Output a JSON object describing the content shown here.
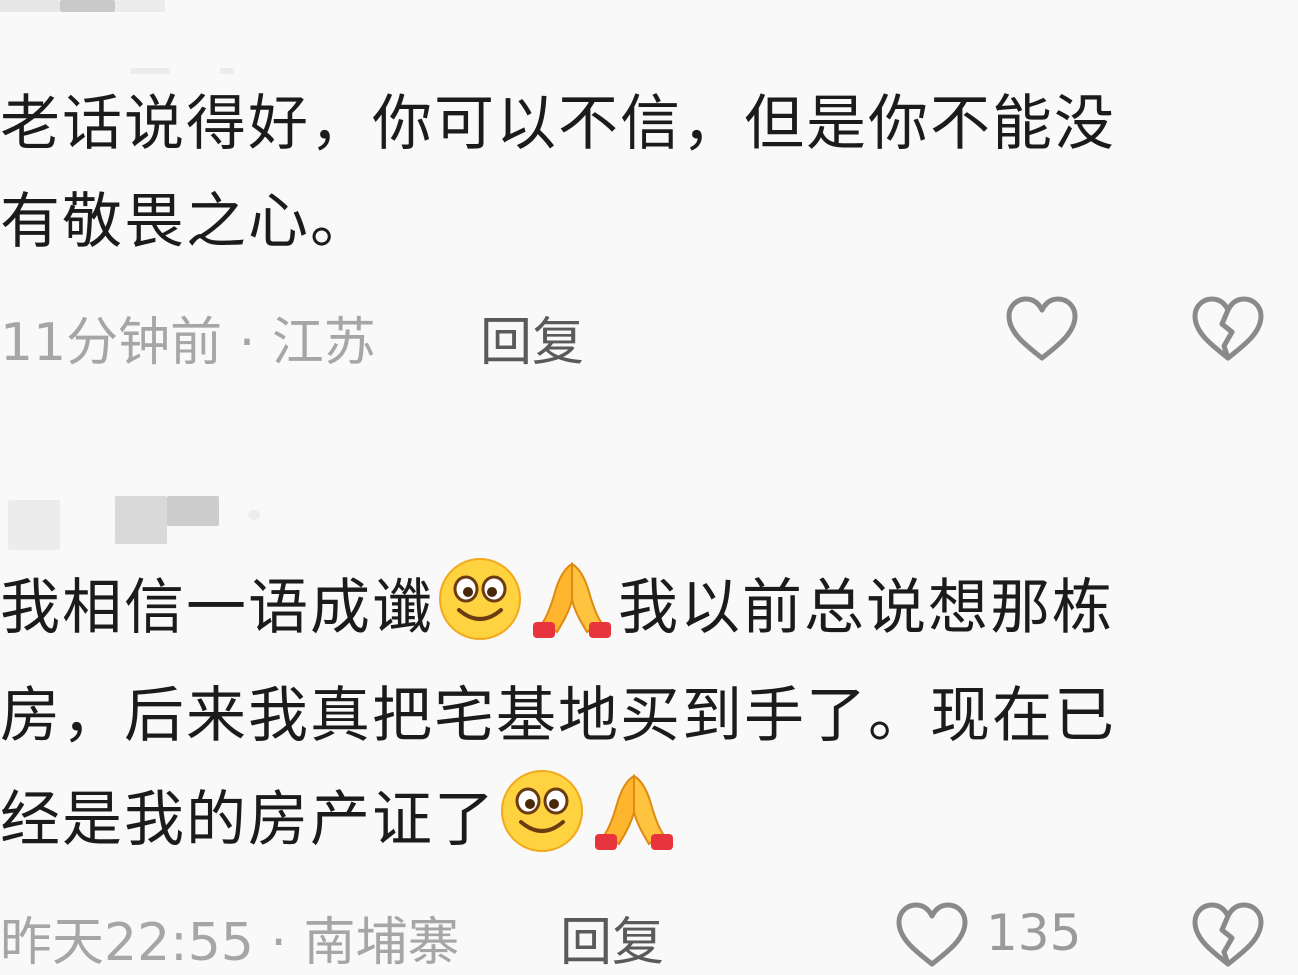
{
  "comments": [
    {
      "lines": [
        "老话说得好，你可以不信，但是你不能没",
        "有敬畏之心。"
      ],
      "meta": "11分钟前 · 江苏",
      "reply_label": "回复"
    },
    {
      "line1_a": "我相信一语成谶",
      "line1_b": "我以前总说想那栋",
      "line2": "房，后来我真把宅基地买到手了。现在已",
      "line3": "经是我的房产证了",
      "meta": "昨天22:55 · 南埔寨",
      "reply_label": "回复",
      "like_count": "135"
    }
  ],
  "icons": {
    "like": "heart-outline-icon",
    "dislike": "broken-heart-icon",
    "smile": "smile-emoji-icon",
    "pray": "pray-hands-emoji-icon"
  },
  "colors": {
    "background": "#f9f9f9",
    "text": "#1b1b1b",
    "meta": "#a6a6a6",
    "reply": "#5a5a5a",
    "icon": "#8a8a8a"
  }
}
